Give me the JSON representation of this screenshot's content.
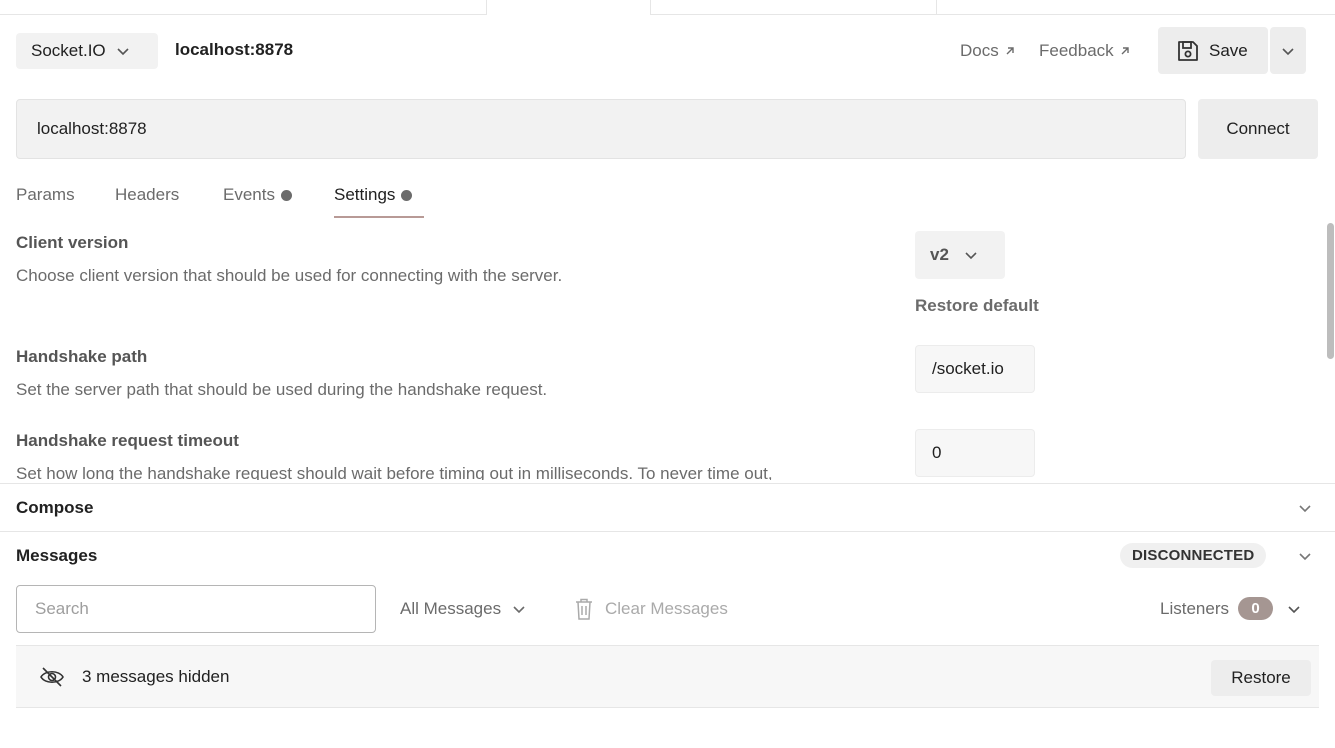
{
  "header": {
    "protocol_label": "Socket.IO",
    "request_name": "localhost:8878",
    "docs_label": "Docs",
    "feedback_label": "Feedback",
    "save_label": "Save"
  },
  "url_bar": {
    "url_value": "localhost:8878",
    "connect_label": "Connect"
  },
  "tabs": [
    {
      "label": "Params",
      "has_dot": false,
      "active": false
    },
    {
      "label": "Headers",
      "has_dot": false,
      "active": false
    },
    {
      "label": "Events",
      "has_dot": true,
      "active": false
    },
    {
      "label": "Settings",
      "has_dot": true,
      "active": true
    }
  ],
  "settings": {
    "client_version": {
      "title": "Client version",
      "description": "Choose client version that should be used for connecting with the server.",
      "value": "v2",
      "restore_label": "Restore default"
    },
    "handshake_path": {
      "title": "Handshake path",
      "description": "Set the server path that should be used during the handshake request.",
      "value": "/socket.io"
    },
    "handshake_timeout": {
      "title": "Handshake request timeout",
      "description": "Set how long the handshake request should wait before timing out in milliseconds. To never time out,",
      "value": "0"
    }
  },
  "compose": {
    "title": "Compose"
  },
  "messages": {
    "title": "Messages",
    "status": "DISCONNECTED",
    "search_placeholder": "Search",
    "filter_label": "All Messages",
    "clear_label": "Clear Messages",
    "listeners_label": "Listeners",
    "listeners_count": "0",
    "hidden_text": "3 messages hidden",
    "restore_label": "Restore"
  },
  "colors": {
    "accent_underline": "#b89a96",
    "badge_bg": "#a59692"
  }
}
